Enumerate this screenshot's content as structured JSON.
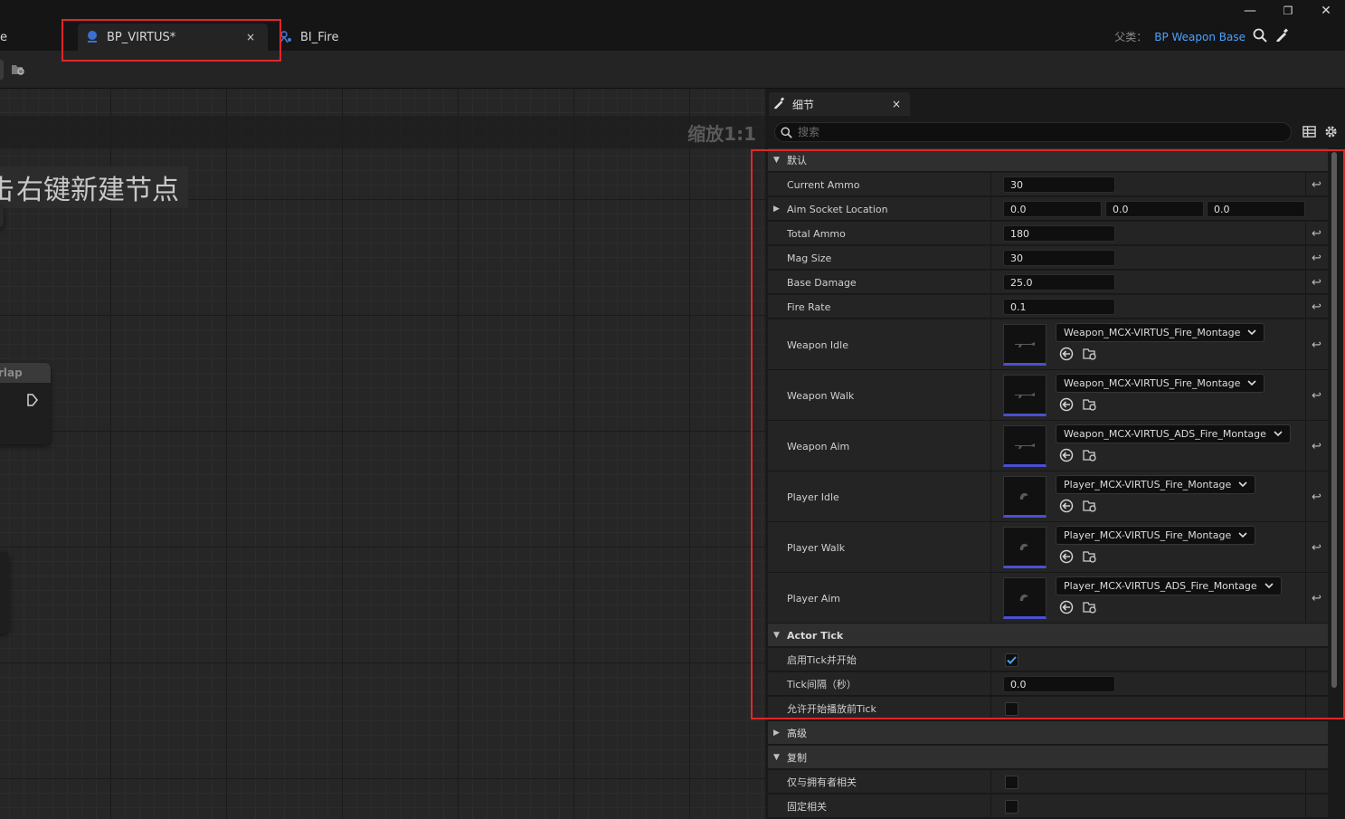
{
  "tabs": [
    {
      "label": "e"
    },
    {
      "label": "BP_VIRTUS*",
      "close": "×"
    },
    {
      "label": "BI_Fire"
    }
  ],
  "window_controls": {
    "minimize": "—",
    "restore": "❐",
    "close": "✕"
  },
  "parent": {
    "label": "父类：",
    "value": "BP Weapon Base"
  },
  "graph": {
    "zoom": "缩放1:1",
    "hint": "右键新建节点",
    "hint_partial": "击",
    "node_title": "rlap"
  },
  "details": {
    "tab_label": "细节",
    "tab_close": "×",
    "search_placeholder": "搜索",
    "categories": {
      "default": "默认",
      "actor_tick": "Actor Tick",
      "advanced": "高级",
      "replication": "复制"
    },
    "rows": {
      "current_ammo": {
        "label": "Current Ammo",
        "value": "30"
      },
      "aim_socket": {
        "label": "Aim Socket Location",
        "x": "0.0",
        "y": "0.0",
        "z": "0.0"
      },
      "total_ammo": {
        "label": "Total Ammo",
        "value": "180"
      },
      "mag_size": {
        "label": "Mag Size",
        "value": "30"
      },
      "base_damage": {
        "label": "Base Damage",
        "value": "25.0"
      },
      "fire_rate": {
        "label": "Fire Rate",
        "value": "0.1"
      },
      "weapon_idle": {
        "label": "Weapon Idle",
        "asset": "Weapon_MCX-VIRTUS_Fire_Montage"
      },
      "weapon_walk": {
        "label": "Weapon Walk",
        "asset": "Weapon_MCX-VIRTUS_Fire_Montage"
      },
      "weapon_aim": {
        "label": "Weapon Aim",
        "asset": "Weapon_MCX-VIRTUS_ADS_Fire_Montage"
      },
      "player_idle": {
        "label": "Player Idle",
        "asset": "Player_MCX-VIRTUS_Fire_Montage"
      },
      "player_walk": {
        "label": "Player Walk",
        "asset": "Player_MCX-VIRTUS_Fire_Montage"
      },
      "player_aim": {
        "label": "Player Aim",
        "asset": "Player_MCX-VIRTUS_ADS_Fire_Montage"
      },
      "start_with_tick": {
        "label": "启用Tick并开始",
        "checked": true
      },
      "tick_interval": {
        "label": "Tick间隔（秒）",
        "value": "0.0"
      },
      "allow_tick_before_begin": {
        "label": "允许开始播放前Tick",
        "checked": false
      },
      "only_relevant_to_owner": {
        "label": "仅与拥有者相关",
        "checked": false
      },
      "always_relevant": {
        "label": "固定相关",
        "checked": false
      }
    }
  },
  "colors": {
    "accent_link": "#4aa2ff",
    "highlight_box": "#e0262b",
    "checkbox_check": "#4aa2ff"
  }
}
